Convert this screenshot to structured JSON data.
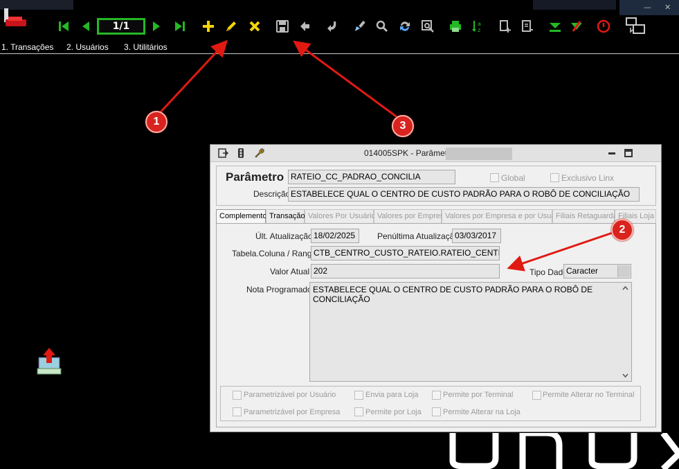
{
  "toolbar": {
    "page_indicator": "1/1"
  },
  "menu": {
    "items": [
      "1. Transações",
      "2. Usuários",
      "3. Utilitários"
    ]
  },
  "annotations": {
    "badges": [
      "1",
      "2",
      "3"
    ]
  },
  "dialog": {
    "title": "014005SPK - Parâmetros",
    "parametro_label": "Parâmetro",
    "parametro_value": "RATEIO_CC_PADRAO_CONCILIA",
    "global_label": "Global",
    "exclusivo_label": "Exclusivo Linx",
    "descricao_label": "Descrição",
    "descricao_value": "ESTABELECE QUAL O CENTRO DE CUSTO PADRÃO PARA O ROBÔ DE CONCILIAÇÃO",
    "tabs": [
      "Complemento",
      "Transação",
      "Valores Por Usuário",
      "Valores por Empresa",
      "Valores por Empresa e por Usuario",
      "Filiais Retaguarda",
      "Filiais Loja"
    ],
    "ult_atualizacao_label": "Últ. Atualização",
    "ult_atualizacao_value": "18/02/2025",
    "penultima_label": "Penúltima Atualização",
    "penultima_value": "03/03/2017",
    "tabela_label": "Tabela.Coluna / Range",
    "tabela_value": "CTB_CENTRO_CUSTO_RATEIO.RATEIO_CENTRO_CUST",
    "valor_atual_label": "Valor Atual",
    "valor_atual_value": "202",
    "tipo_dado_label": "Tipo Dado",
    "tipo_dado_value": "Caracter",
    "nota_label": "Nota Programador",
    "nota_value": "ESTABELECE QUAL O CENTRO DE CUSTO PADRÃO PARA O ROBÔ DE CONCILIAÇÃO",
    "flags": {
      "parametrizavel_usuario": "Parametrizável por Usuário",
      "envia_loja": "Envia para Loja",
      "permite_terminal": "Permite por Terminal",
      "permite_alterar_terminal": "Permite Alterar no Terminal",
      "parametrizavel_empresa": "Parametrizável por Empresa",
      "permite_loja": "Permite por Loja",
      "permite_alterar_loja": "Permite Alterar na Loja"
    }
  },
  "colors": {
    "toolbar_green": "#25b825",
    "toolbar_yellow": "#f4d40a",
    "annotation_red": "#e01a12"
  }
}
